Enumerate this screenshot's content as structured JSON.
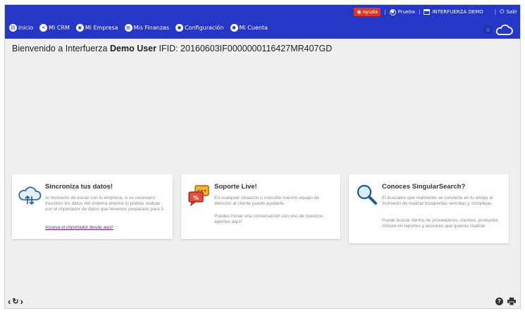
{
  "header": {
    "help_label": "Ayuda",
    "user_label": "Prueba",
    "company_label": "INTERFUERZA DEMO",
    "logout_label": "Salir"
  },
  "nav": {
    "items": [
      {
        "label": "Inicio",
        "icon": "bars-icon"
      },
      {
        "label": "Mi CRM",
        "icon": "share-icon"
      },
      {
        "label": "Mi Empresa",
        "icon": "store-icon"
      },
      {
        "label": "Mis Finanzas",
        "icon": "wallet-icon"
      },
      {
        "label": "Configuración",
        "icon": "gear-icon"
      },
      {
        "label": "Mi Cuenta",
        "icon": "user-icon"
      }
    ]
  },
  "welcome": {
    "prefix": "Bienvenido a Interfuerza",
    "user": "Demo User",
    "ifid": "IFID: 20160603IF0000000116427MR407GD"
  },
  "cards": [
    {
      "title": "Sincroniza tus datos!",
      "text": "Al momento de iniciar con tu empresa, si es necesario transferir los datos del sistema anterior lo podrás realizar con el importador de datos que tenemos preparado para ti.",
      "link": "Accesa el importador desde aquí!"
    },
    {
      "title": "Soporte Live!",
      "text1": "En cualquier situación o consulta nuestro equipo de atención al cliente puede ayudarle.",
      "text2": "Puedes iniciar una conversación con uno de nuestros agentes aquí!"
    },
    {
      "title": "Conoces SingularSearch?",
      "text1": "El buscador que realmente se convierte en tu amigo al momento de realizar búsquedas sencillas y complejas.",
      "text2": "Puede buscar dentro de proveedores, clientes, productos incluso en reportes y acciones que quieras realizar."
    }
  ],
  "colors": {
    "topbar": "#2437c7",
    "help_badge": "#e8331b",
    "link": "#7a1f8f"
  }
}
